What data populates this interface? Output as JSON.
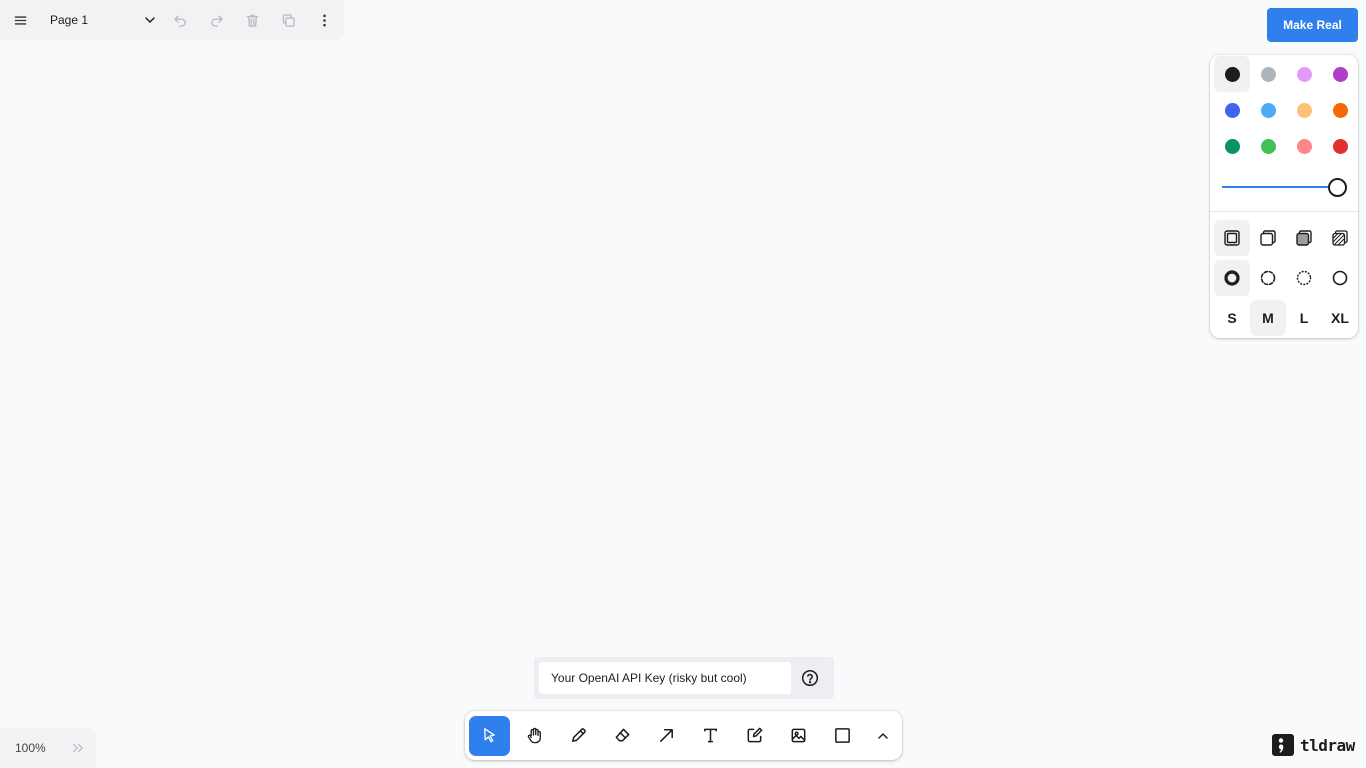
{
  "menu": {
    "page_name": "Page 1",
    "icons": [
      "hamburger-menu-icon",
      "chevron-down-icon",
      "undo-icon",
      "redo-icon",
      "trash-icon",
      "duplicate-icon",
      "more-vertical-icon"
    ]
  },
  "make_real": {
    "label": "Make Real",
    "color": "#2f80ed"
  },
  "style_panel": {
    "colors": [
      {
        "name": "black",
        "hex": "#1d1d1d",
        "selected": true
      },
      {
        "name": "grey",
        "hex": "#adb5bd"
      },
      {
        "name": "light-violet",
        "hex": "#e599f7"
      },
      {
        "name": "violet",
        "hex": "#ae3ec9"
      },
      {
        "name": "blue",
        "hex": "#4263eb"
      },
      {
        "name": "light-blue",
        "hex": "#4dabf7"
      },
      {
        "name": "yellow",
        "hex": "#ffc078"
      },
      {
        "name": "orange",
        "hex": "#f76707"
      },
      {
        "name": "green",
        "hex": "#099268"
      },
      {
        "name": "light-green",
        "hex": "#40c057"
      },
      {
        "name": "light-red",
        "hex": "#ff8787"
      },
      {
        "name": "red",
        "hex": "#e03131"
      }
    ],
    "opacity": 1.0,
    "fill_styles": [
      "fill-none-icon",
      "fill-semi-icon",
      "fill-solid-icon",
      "fill-pattern-icon"
    ],
    "selected_fill": 0,
    "dash_styles": [
      "dash-draw-icon",
      "dash-dashed-icon",
      "dash-dotted-icon",
      "dash-solid-icon"
    ],
    "selected_dash": 0,
    "sizes": {
      "s": "S",
      "m": "M",
      "l": "L",
      "xl": "XL"
    },
    "selected_size": "M"
  },
  "api_key": {
    "placeholder": "Your OpenAI API Key (risky but cool)",
    "help_icon": "help-circle-icon"
  },
  "toolbar": {
    "tools": [
      "select-tool-icon",
      "hand-tool-icon",
      "draw-tool-icon",
      "eraser-tool-icon",
      "arrow-tool-icon",
      "text-tool-icon",
      "note-tool-icon",
      "asset-tool-icon",
      "rectangle-tool-icon",
      "chevron-up-icon"
    ],
    "active": "select"
  },
  "zoom": {
    "label": "100%"
  },
  "brand": {
    "name": "tldraw"
  }
}
